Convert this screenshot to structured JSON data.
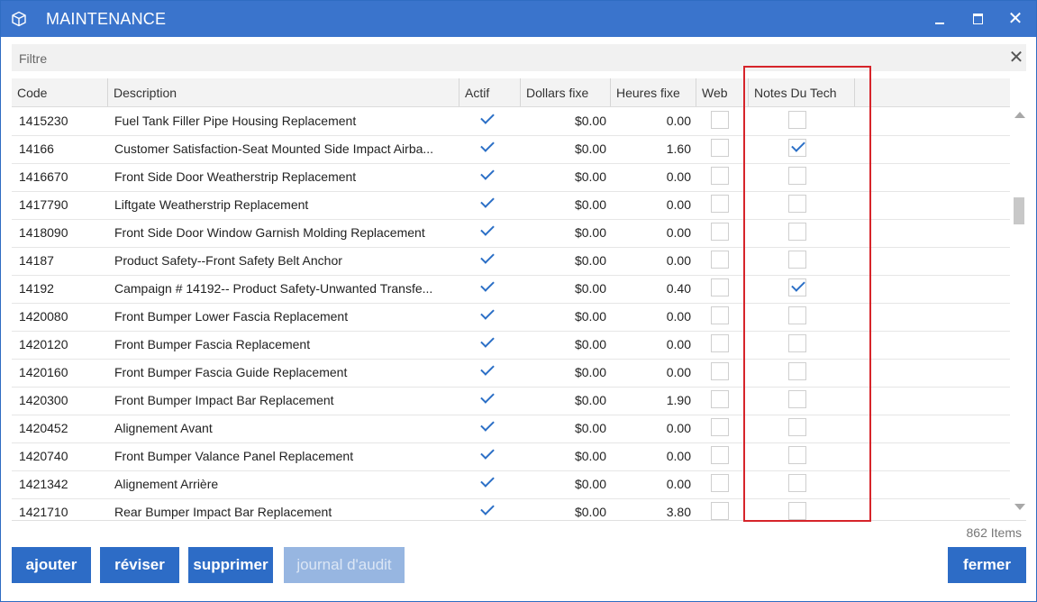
{
  "window": {
    "title": "MAINTENANCE",
    "icon": "cube-icon",
    "controls": [
      "minimize-icon",
      "maximize-icon",
      "close-icon"
    ]
  },
  "filter": {
    "placeholder": "Filtre",
    "value": ""
  },
  "grid": {
    "columns": [
      "Code",
      "Description",
      "Actif",
      "Dollars fixe",
      "Heures fixe",
      "Web",
      "Notes Du Tech"
    ],
    "rows": [
      {
        "code": "1415230",
        "description": "Fuel Tank Filler Pipe Housing Replacement",
        "actif": true,
        "dollars": "$0.00",
        "heures": "0.00",
        "web": false,
        "notes": false
      },
      {
        "code": "14166",
        "description": "Customer Satisfaction-Seat Mounted Side Impact Airba...",
        "actif": true,
        "dollars": "$0.00",
        "heures": "1.60",
        "web": false,
        "notes": true
      },
      {
        "code": "1416670",
        "description": "Front Side Door Weatherstrip Replacement",
        "actif": true,
        "dollars": "$0.00",
        "heures": "0.00",
        "web": false,
        "notes": false
      },
      {
        "code": "1417790",
        "description": "Liftgate Weatherstrip Replacement",
        "actif": true,
        "dollars": "$0.00",
        "heures": "0.00",
        "web": false,
        "notes": false
      },
      {
        "code": "1418090",
        "description": "Front Side Door Window Garnish Molding Replacement",
        "actif": true,
        "dollars": "$0.00",
        "heures": "0.00",
        "web": false,
        "notes": false
      },
      {
        "code": "14187",
        "description": "Product Safety--Front Safety Belt Anchor",
        "actif": true,
        "dollars": "$0.00",
        "heures": "0.00",
        "web": false,
        "notes": false
      },
      {
        "code": "14192",
        "description": "Campaign # 14192-- Product Safety-Unwanted Transfe...",
        "actif": true,
        "dollars": "$0.00",
        "heures": "0.40",
        "web": false,
        "notes": true
      },
      {
        "code": "1420080",
        "description": "Front Bumper Lower Fascia Replacement",
        "actif": true,
        "dollars": "$0.00",
        "heures": "0.00",
        "web": false,
        "notes": false
      },
      {
        "code": "1420120",
        "description": "Front Bumper Fascia Replacement",
        "actif": true,
        "dollars": "$0.00",
        "heures": "0.00",
        "web": false,
        "notes": false
      },
      {
        "code": "1420160",
        "description": "Front Bumper Fascia Guide Replacement",
        "actif": true,
        "dollars": "$0.00",
        "heures": "0.00",
        "web": false,
        "notes": false
      },
      {
        "code": "1420300",
        "description": "Front Bumper Impact Bar Replacement",
        "actif": true,
        "dollars": "$0.00",
        "heures": "1.90",
        "web": false,
        "notes": false
      },
      {
        "code": "1420452",
        "description": "Alignement Avant",
        "actif": true,
        "dollars": "$0.00",
        "heures": "0.00",
        "web": false,
        "notes": false
      },
      {
        "code": "1420740",
        "description": "Front Bumper Valance Panel Replacement",
        "actif": true,
        "dollars": "$0.00",
        "heures": "0.00",
        "web": false,
        "notes": false
      },
      {
        "code": "1421342",
        "description": "Alignement Arrière",
        "actif": true,
        "dollars": "$0.00",
        "heures": "0.00",
        "web": false,
        "notes": false
      },
      {
        "code": "1421710",
        "description": "Rear Bumper Impact Bar Replacement",
        "actif": true,
        "dollars": "$0.00",
        "heures": "3.80",
        "web": false,
        "notes": false
      }
    ]
  },
  "status": {
    "items_count": "862 Items"
  },
  "buttons": {
    "add": "ajouter",
    "edit": "réviser",
    "delete": "supprimer",
    "audit": "journal d'audit",
    "close": "fermer"
  },
  "colors": {
    "accent": "#2d6cc6",
    "highlight": "#d6242a"
  }
}
